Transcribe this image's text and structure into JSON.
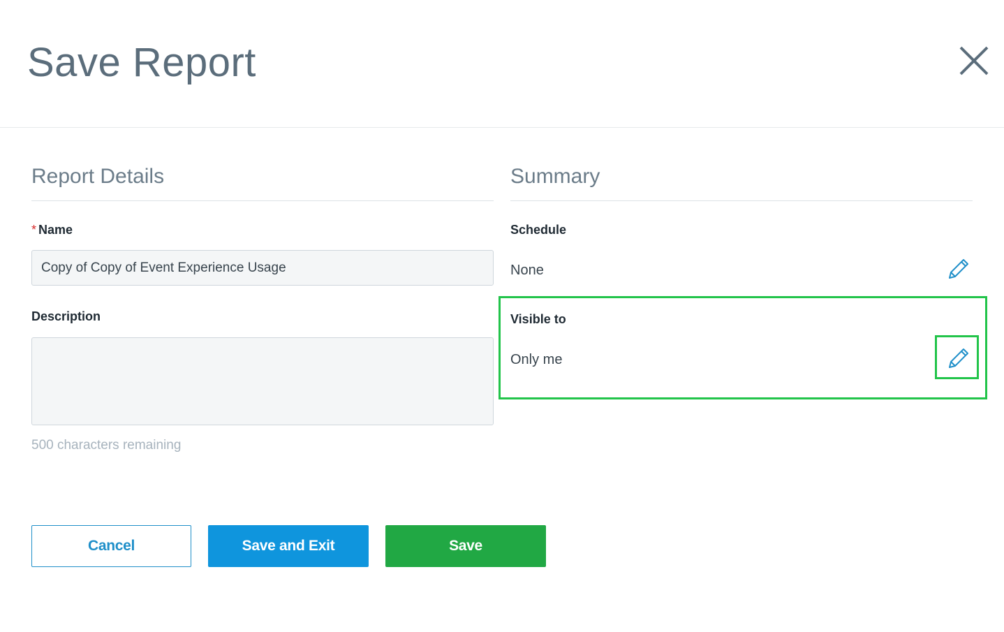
{
  "dialog": {
    "title": "Save Report",
    "close_icon": "close-icon"
  },
  "report_details": {
    "heading": "Report Details",
    "name_label": "Name",
    "name_required_marker": "*",
    "name_value": "Copy of Copy of Event Experience Usage",
    "description_label": "Description",
    "description_value": "",
    "char_remaining": "500 characters remaining"
  },
  "summary": {
    "heading": "Summary",
    "schedule_label": "Schedule",
    "schedule_value": "None",
    "visible_label": "Visible to",
    "visible_value": "Only me",
    "edit_icon": "pencil-icon"
  },
  "actions": {
    "cancel_label": "Cancel",
    "save_exit_label": "Save and Exit",
    "save_label": "Save"
  },
  "colors": {
    "primary_blue": "#0f95dd",
    "save_green": "#21a844",
    "highlight_green": "#22c44a",
    "required_red": "#d62b2b"
  }
}
